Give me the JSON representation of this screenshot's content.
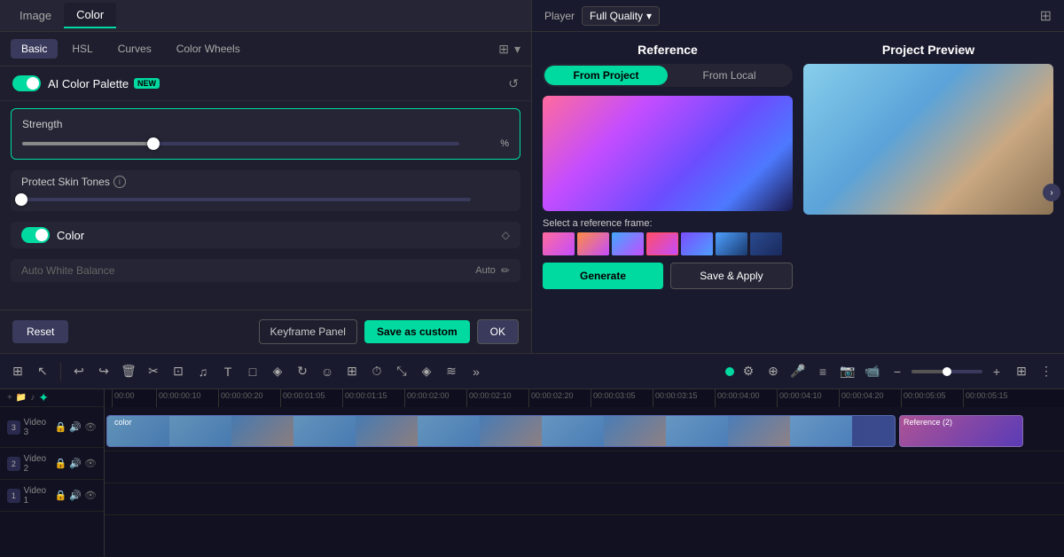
{
  "tabs": {
    "image": "Image",
    "color": "Color"
  },
  "sub_tabs": {
    "basic": "Basic",
    "hsl": "HSL",
    "curves": "Curves",
    "color_wheels": "Color Wheels"
  },
  "ai_palette": {
    "label": "AI Color Palette",
    "badge": "NEW"
  },
  "strength": {
    "label": "Strength",
    "value": "30",
    "unit": "%"
  },
  "protect_skin": {
    "label": "Protect Skin Tones",
    "value": "0"
  },
  "color": {
    "label": "Color"
  },
  "auto_wb": {
    "label": "Auto White Balance",
    "badge": "Auto"
  },
  "actions": {
    "reset": "Reset",
    "keyframe": "Keyframe Panel",
    "save_custom": "Save as custom",
    "ok": "OK"
  },
  "player": {
    "label": "Player",
    "quality": "Full Quality"
  },
  "reference": {
    "title": "Reference",
    "from_project": "From Project",
    "from_local": "From Local",
    "frame_label": "Select a reference frame:",
    "generate": "Generate",
    "save_apply": "Save & Apply"
  },
  "preview": {
    "title": "Project Preview"
  },
  "timeline": {
    "tracks": [
      {
        "num": "3",
        "label": "Video 3"
      },
      {
        "num": "2",
        "label": "Video 2"
      },
      {
        "num": "1",
        "label": "Video 1"
      }
    ],
    "time_markers": [
      "00:00",
      "00:00:00:10",
      "00:00:00:20",
      "00:00:01:05",
      "00:00:01:15",
      "00:00:02:00",
      "00:00:02:10",
      "00:00:02:20",
      "00:00:03:05",
      "00:00:03:15",
      "00:00:04:00",
      "00:00:04:10",
      "00:00:04:20",
      "00:00:05:05",
      "00:00:05:15"
    ],
    "clip_label": "color",
    "ref_label": "Reference (2)"
  }
}
